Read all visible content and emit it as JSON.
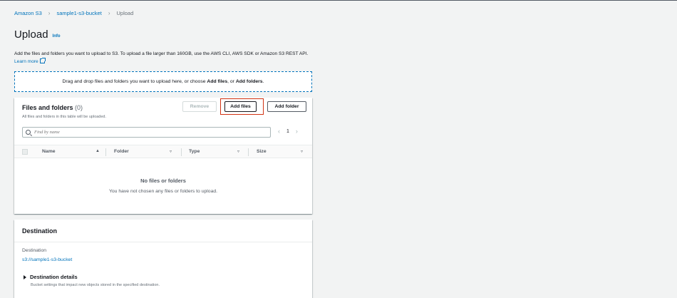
{
  "breadcrumb": {
    "items": [
      "Amazon S3",
      "sample1-s3-bucket"
    ],
    "current": "Upload"
  },
  "header": {
    "title": "Upload",
    "info": "Info"
  },
  "description": {
    "text": "Add the files and folders you want to upload to S3. To upload a file larger than 160GB, use the AWS CLI, AWS SDK or Amazon S3 REST API.",
    "learn_more": "Learn more"
  },
  "dropzone": {
    "prefix": "Drag and drop files and folders you want to upload here, or choose ",
    "add_files": "Add files",
    "mid": ", or ",
    "add_folders": "Add folders",
    "suffix": "."
  },
  "files_panel": {
    "title": "Files and folders",
    "count": "(0)",
    "subtitle": "All files and folders in this table will be uploaded.",
    "remove_label": "Remove",
    "add_files_label": "Add files",
    "add_folder_label": "Add folder",
    "search_placeholder": "Find by name",
    "page": "1",
    "columns": [
      "Name",
      "Folder",
      "Type",
      "Size"
    ],
    "empty_title": "No files or folders",
    "empty_sub": "You have not chosen any files or folders to upload."
  },
  "destination": {
    "title": "Destination",
    "label": "Destination",
    "value": "s3://sample1-s3-bucket",
    "details_label": "Destination details",
    "details_sub": "Bucket settings that impact new objects stored in the specified destination."
  }
}
